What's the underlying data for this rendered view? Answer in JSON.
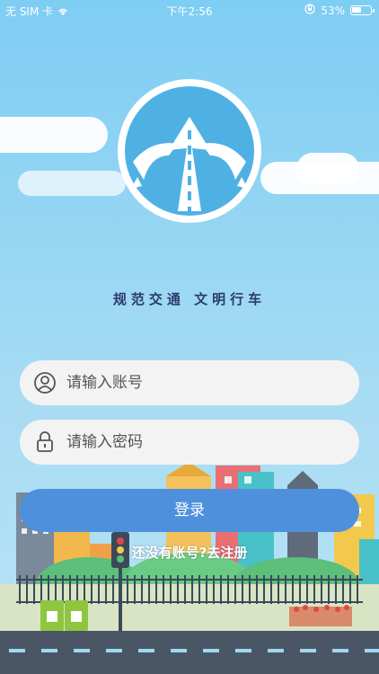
{
  "status_bar": {
    "carrier": "无 SIM 卡",
    "time": "下午2:56",
    "battery": "53%",
    "battery_level": 0.53
  },
  "app": {
    "slogan": "规范交通  文明行车"
  },
  "form": {
    "account_placeholder": "请输入账号",
    "password_placeholder": "请输入密码",
    "login_label": "登录",
    "register_prompt": "还没有账号?去注册"
  },
  "icons": {
    "wifi": "wifi-icon",
    "lock_rotation": "orientation-lock-icon",
    "user": "user-icon",
    "lock": "lock-icon",
    "logo": "road-arrow-logo"
  },
  "colors": {
    "sky": "#8fd3f2",
    "logo_blue": "#4fb1e3",
    "button": "#4f90dd",
    "slogan": "#2a3a6e"
  }
}
